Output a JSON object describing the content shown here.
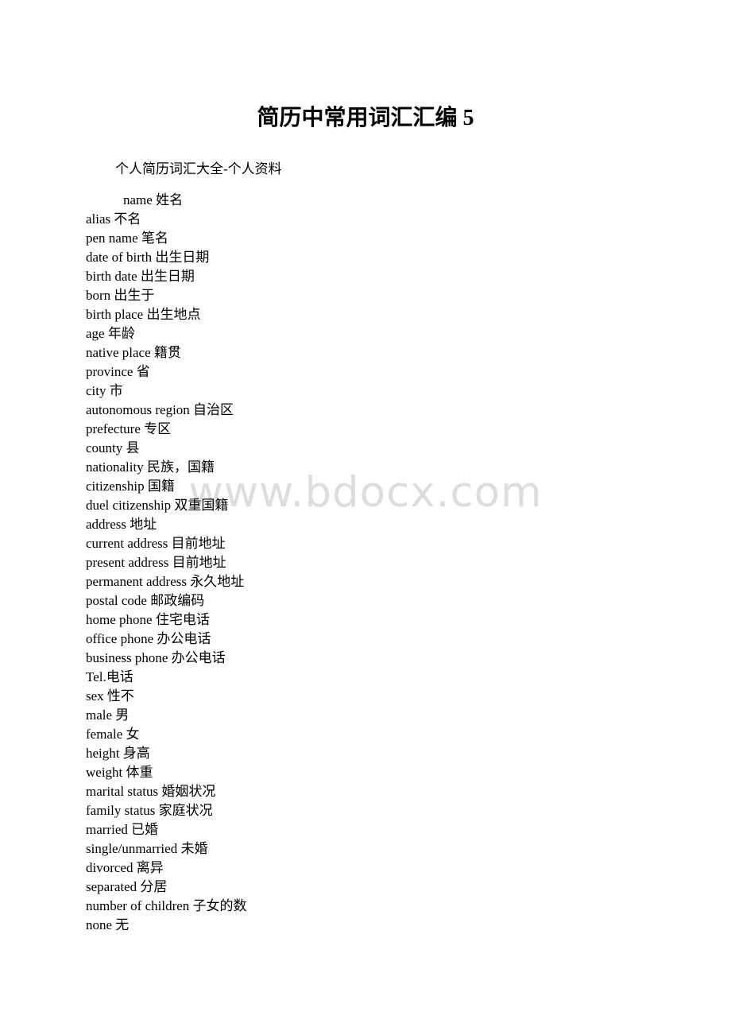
{
  "document": {
    "title": "简历中常用词汇汇编 5",
    "subtitle": "个人简历词汇大全-个人资料",
    "watermark": "www.bdocx.com",
    "watermark_color": "#dddddd",
    "text_color": "#000000",
    "background_color": "#ffffff",
    "terms": [
      {
        "text": "name 姓名",
        "indented": true
      },
      {
        "text": "alias 不名",
        "indented": false
      },
      {
        "text": "pen name 笔名",
        "indented": false
      },
      {
        "text": "date of birth 出生日期",
        "indented": false
      },
      {
        "text": "birth date 出生日期",
        "indented": false
      },
      {
        "text": "born 出生于",
        "indented": false
      },
      {
        "text": "birth place 出生地点",
        "indented": false
      },
      {
        "text": "age 年龄",
        "indented": false
      },
      {
        "text": "native place 籍贯",
        "indented": false
      },
      {
        "text": "province 省",
        "indented": false
      },
      {
        "text": "city 市",
        "indented": false
      },
      {
        "text": "autonomous region 自治区",
        "indented": false
      },
      {
        "text": "prefecture 专区",
        "indented": false
      },
      {
        "text": "county 县",
        "indented": false
      },
      {
        "text": "nationality 民族，国籍",
        "indented": false
      },
      {
        "text": "citizenship 国籍",
        "indented": false
      },
      {
        "text": "duel citizenship 双重国籍",
        "indented": false
      },
      {
        "text": "address 地址",
        "indented": false
      },
      {
        "text": "current address 目前地址",
        "indented": false
      },
      {
        "text": "present address 目前地址",
        "indented": false
      },
      {
        "text": "permanent address 永久地址",
        "indented": false
      },
      {
        "text": "postal code 邮政编码",
        "indented": false
      },
      {
        "text": "home phone 住宅电话",
        "indented": false
      },
      {
        "text": "office phone 办公电话",
        "indented": false
      },
      {
        "text": "business phone 办公电话",
        "indented": false
      },
      {
        "text": "Tel.电话",
        "indented": false
      },
      {
        "text": "sex 性不",
        "indented": false
      },
      {
        "text": "male 男",
        "indented": false
      },
      {
        "text": "female 女",
        "indented": false
      },
      {
        "text": "height 身高",
        "indented": false
      },
      {
        "text": "weight 体重",
        "indented": false
      },
      {
        "text": "marital status 婚姻状况",
        "indented": false
      },
      {
        "text": "family status 家庭状况",
        "indented": false
      },
      {
        "text": "married 已婚",
        "indented": false
      },
      {
        "text": "single/unmarried 未婚",
        "indented": false
      },
      {
        "text": "divorced 离异",
        "indented": false
      },
      {
        "text": "separated 分居",
        "indented": false
      },
      {
        "text": "number of children 子女的数",
        "indented": false
      },
      {
        "text": "none 无",
        "indented": false
      }
    ]
  }
}
